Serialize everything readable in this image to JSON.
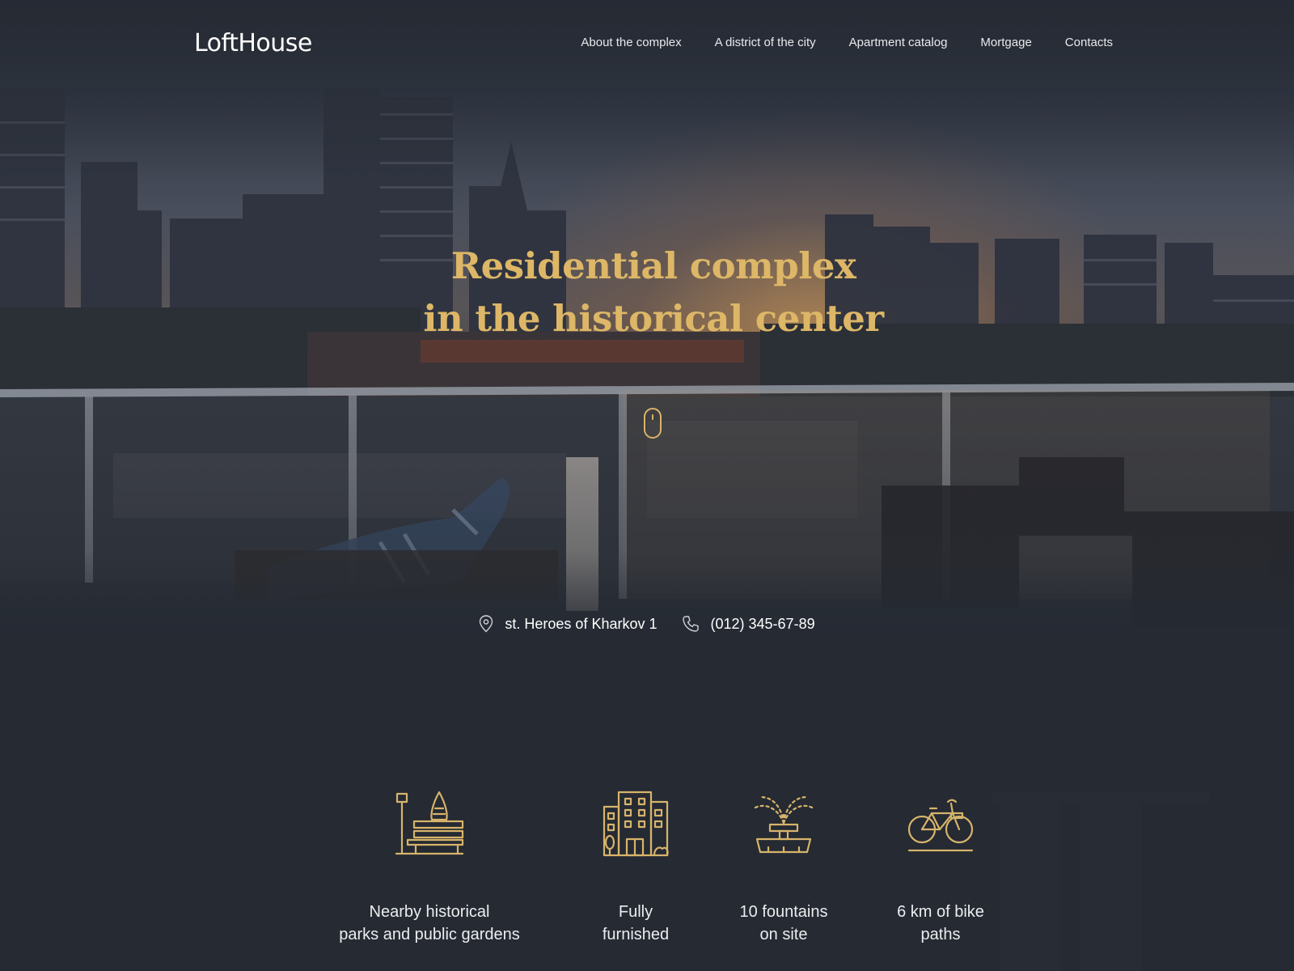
{
  "brand": {
    "logo": "LoftHouse",
    "accent_color": "#ddb767",
    "background_color": "#252a33"
  },
  "nav": {
    "items": [
      {
        "label": "About the complex"
      },
      {
        "label": "A district of the city"
      },
      {
        "label": "Apartment catalog"
      },
      {
        "label": "Mortgage"
      },
      {
        "label": "Contacts"
      }
    ]
  },
  "hero": {
    "title_line1": "Residential complex",
    "title_line2": "in the historical center",
    "scroll_icon": "mouse-scroll-icon",
    "address_icon": "location-pin-icon",
    "address": "st. Heroes of Kharkov 1",
    "phone_icon": "phone-icon",
    "phone": "(012) 345-67-89"
  },
  "features": [
    {
      "icon": "park-bench-icon",
      "line1": "Nearby historical",
      "line2": "parks and public gardens"
    },
    {
      "icon": "building-icon",
      "line1": "Fully",
      "line2": "furnished"
    },
    {
      "icon": "fountain-icon",
      "line1": "10 fountains",
      "line2": "on site"
    },
    {
      "icon": "bicycle-icon",
      "line1": "6 km of bike",
      "line2": "paths"
    }
  ]
}
